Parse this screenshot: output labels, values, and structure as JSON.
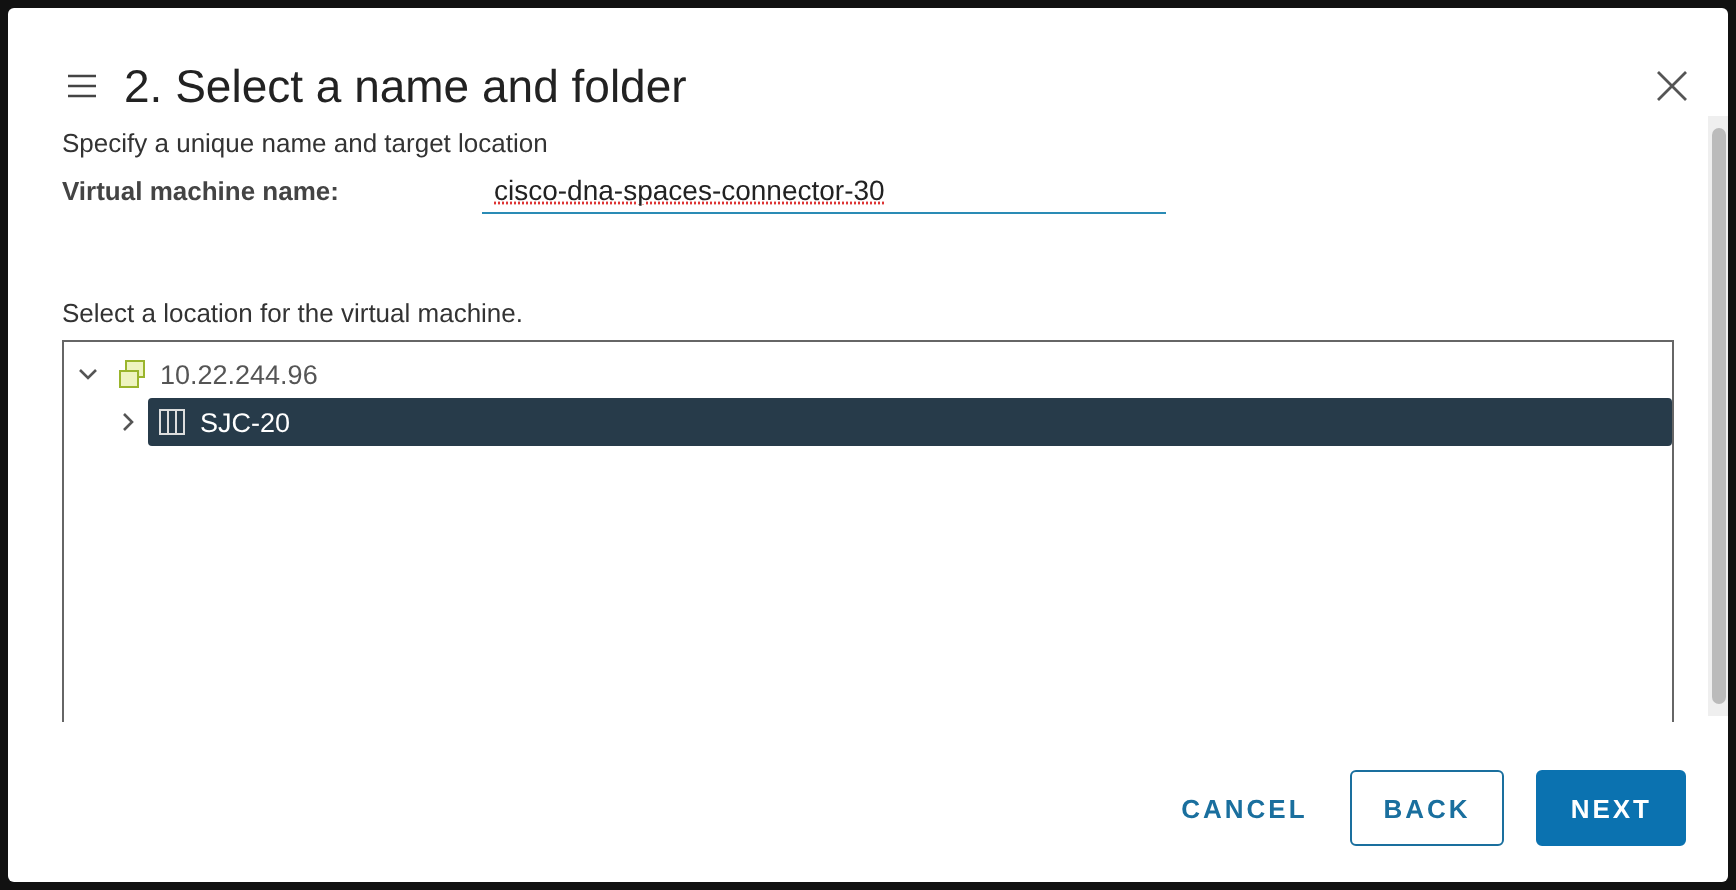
{
  "dialog": {
    "title": "2. Select a name and folder"
  },
  "intro": "Specify a unique name and target location",
  "name_field": {
    "label": "Virtual machine name:",
    "value": "cisco-dna-spaces-connector-30"
  },
  "location_label": "Select a location for the virtual machine.",
  "tree": [
    {
      "label": "10.22.244.96",
      "kind": "vcenter",
      "expanded": true,
      "selected": false,
      "children": [
        {
          "label": "SJC-20",
          "kind": "datacenter",
          "expanded": false,
          "selected": true
        }
      ]
    }
  ],
  "buttons": [
    {
      "label": "CANCEL",
      "kind": "flat"
    },
    {
      "label": "BACK",
      "kind": "outline"
    },
    {
      "label": "NEXT",
      "kind": "primary"
    }
  ]
}
